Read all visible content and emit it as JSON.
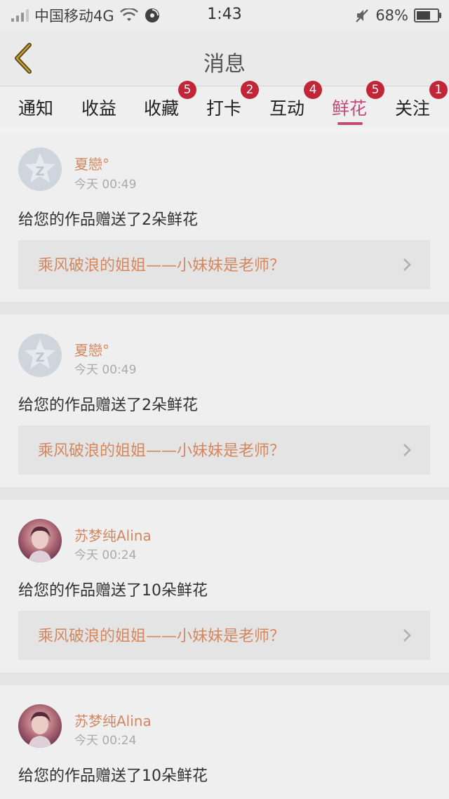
{
  "status_bar": {
    "carrier": "中国移动4G",
    "time": "1:43",
    "battery": "68%",
    "battery_level": 0.68
  },
  "navbar": {
    "title": "消息"
  },
  "tabs": [
    {
      "label": "通知",
      "badge": ""
    },
    {
      "label": "收益",
      "badge": ""
    },
    {
      "label": "收藏",
      "badge": "5"
    },
    {
      "label": "打卡",
      "badge": "2"
    },
    {
      "label": "互动",
      "badge": "4"
    },
    {
      "label": "鲜花",
      "badge": "5",
      "active": true
    },
    {
      "label": "关注",
      "badge": "1"
    }
  ],
  "messages": [
    {
      "name": "夏戀°",
      "time": "今天 00:49",
      "text": "给您的作品赠送了2朵鲜花",
      "work": "乘风破浪的姐姐——小妹妹是老师？",
      "avatar": "qq-default-icon"
    },
    {
      "name": "夏戀°",
      "time": "今天 00:49",
      "text": "给您的作品赠送了2朵鲜花",
      "work": "乘风破浪的姐姐——小妹妹是老师？",
      "avatar": "qq-default-icon"
    },
    {
      "name": "苏梦纯Alina",
      "time": "今天 00:24",
      "text": "给您的作品赠送了10朵鲜花",
      "work": "乘风破浪的姐姐——小妹妹是老师？",
      "avatar": "user-photo"
    },
    {
      "name": "苏梦纯Alina",
      "time": "今天 00:24",
      "text": "给您的作品赠送了10朵鲜花",
      "avatar": "user-photo"
    }
  ],
  "colors": {
    "accent": "#c94f7c",
    "badge": "#c8283a",
    "name": "#d98c63"
  }
}
